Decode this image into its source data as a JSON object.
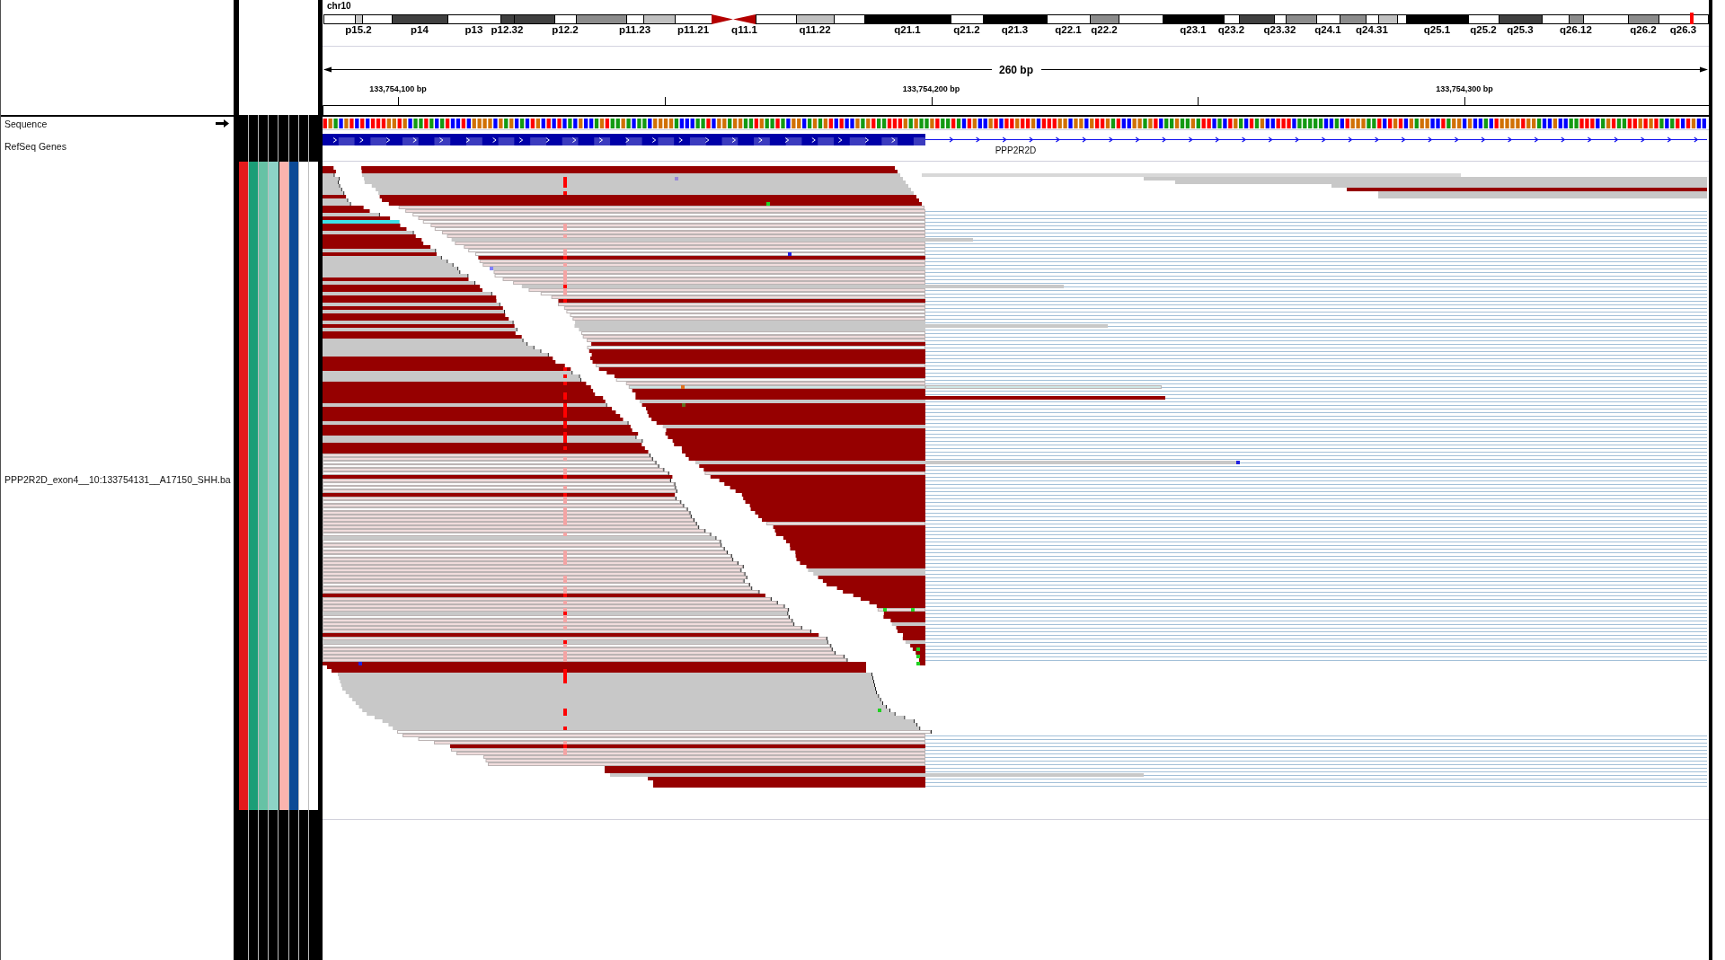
{
  "ideogram": {
    "chromosome": "chr10",
    "bands": [
      {
        "kind": "band",
        "color": "#ffffff"
      },
      {
        "kind": "band",
        "color": "#c8c8c8",
        "label": "p15.2"
      },
      {
        "kind": "band",
        "color": "#ffffff"
      },
      {
        "kind": "band",
        "color": "#404040",
        "label": "p14"
      },
      {
        "kind": "band",
        "color": "#ffffff",
        "label": "p13"
      },
      {
        "kind": "band",
        "color": "#404040",
        "label": "p12.32"
      },
      {
        "kind": "band",
        "color": "#404040"
      },
      {
        "kind": "band",
        "color": "#ffffff",
        "label": "p12.2"
      },
      {
        "kind": "band",
        "color": "#8c8c8c"
      },
      {
        "kind": "band",
        "color": "#ffffff",
        "label": "p11.23"
      },
      {
        "kind": "band",
        "color": "#c0c0c0"
      },
      {
        "kind": "band",
        "color": "#ffffff",
        "label": "p11.21"
      },
      {
        "kind": "centromere",
        "color": "#b40000"
      },
      {
        "kind": "centromere",
        "color": "#b40000",
        "label": "q11.1"
      },
      {
        "kind": "band",
        "color": "#ffffff"
      },
      {
        "kind": "band",
        "color": "#c0c0c0",
        "label": "q11.22"
      },
      {
        "kind": "band",
        "color": "#ffffff"
      },
      {
        "kind": "band",
        "color": "#000000",
        "label": "q21.1"
      },
      {
        "kind": "band",
        "color": "#ffffff",
        "label": "q21.2"
      },
      {
        "kind": "band",
        "color": "#000000",
        "label": "q21.3"
      },
      {
        "kind": "band",
        "color": "#ffffff",
        "label": "q22.1"
      },
      {
        "kind": "band",
        "color": "#8c8c8c",
        "label": "q22.2"
      },
      {
        "kind": "band",
        "color": "#ffffff"
      },
      {
        "kind": "band",
        "color": "#000000",
        "label": "q23.1"
      },
      {
        "kind": "band",
        "color": "#ffffff",
        "label": "q23.2"
      },
      {
        "kind": "band",
        "color": "#404040"
      },
      {
        "kind": "band",
        "color": "#ffffff",
        "label": "q23.32"
      },
      {
        "kind": "band",
        "color": "#8c8c8c"
      },
      {
        "kind": "band",
        "color": "#ffffff",
        "label": "q24.1"
      },
      {
        "kind": "band",
        "color": "#8c8c8c"
      },
      {
        "kind": "band",
        "color": "#ffffff",
        "label": "q24.31"
      },
      {
        "kind": "band",
        "color": "#c0c0c0"
      },
      {
        "kind": "band",
        "color": "#ffffff"
      },
      {
        "kind": "band",
        "color": "#000000",
        "label": "q25.1"
      },
      {
        "kind": "band",
        "color": "#ffffff",
        "label": "q25.2"
      },
      {
        "kind": "band",
        "color": "#404040",
        "label": "q25.3"
      },
      {
        "kind": "band",
        "color": "#ffffff"
      },
      {
        "kind": "band",
        "color": "#8c8c8c",
        "label": "q26.12"
      },
      {
        "kind": "band",
        "color": "#ffffff"
      },
      {
        "kind": "band",
        "color": "#8c8c8c",
        "label": "q26.2"
      },
      {
        "kind": "band",
        "color": "#ffffff",
        "label": "q26.3"
      }
    ]
  },
  "ruler": {
    "span": "260 bp",
    "ticks": [
      {
        "label": "133,754,100 bp"
      },
      {
        "label": "133,754,200 bp"
      },
      {
        "label": "133,754,300 bp"
      }
    ]
  },
  "tracks": [
    {
      "kind": "sequence",
      "name": "Sequence"
    },
    {
      "kind": "genes",
      "name": "RefSeq Genes",
      "gene": "PPP2R2D"
    },
    {
      "kind": "alignment",
      "name": "PPP2R2D_exon4__10:133754131__A17150_SHH.ba",
      "attributes": [
        {
          "color": "#e41a1c"
        },
        {
          "color": "#1b9e77"
        },
        {
          "color": "#66c2a5"
        },
        {
          "color": "#8dd3c7"
        },
        {
          "color": "#fbb4ae"
        },
        {
          "color": "#0c4a96"
        },
        {
          "color": "#ffffff"
        },
        {
          "color": "#ffffff"
        }
      ]
    }
  ]
}
